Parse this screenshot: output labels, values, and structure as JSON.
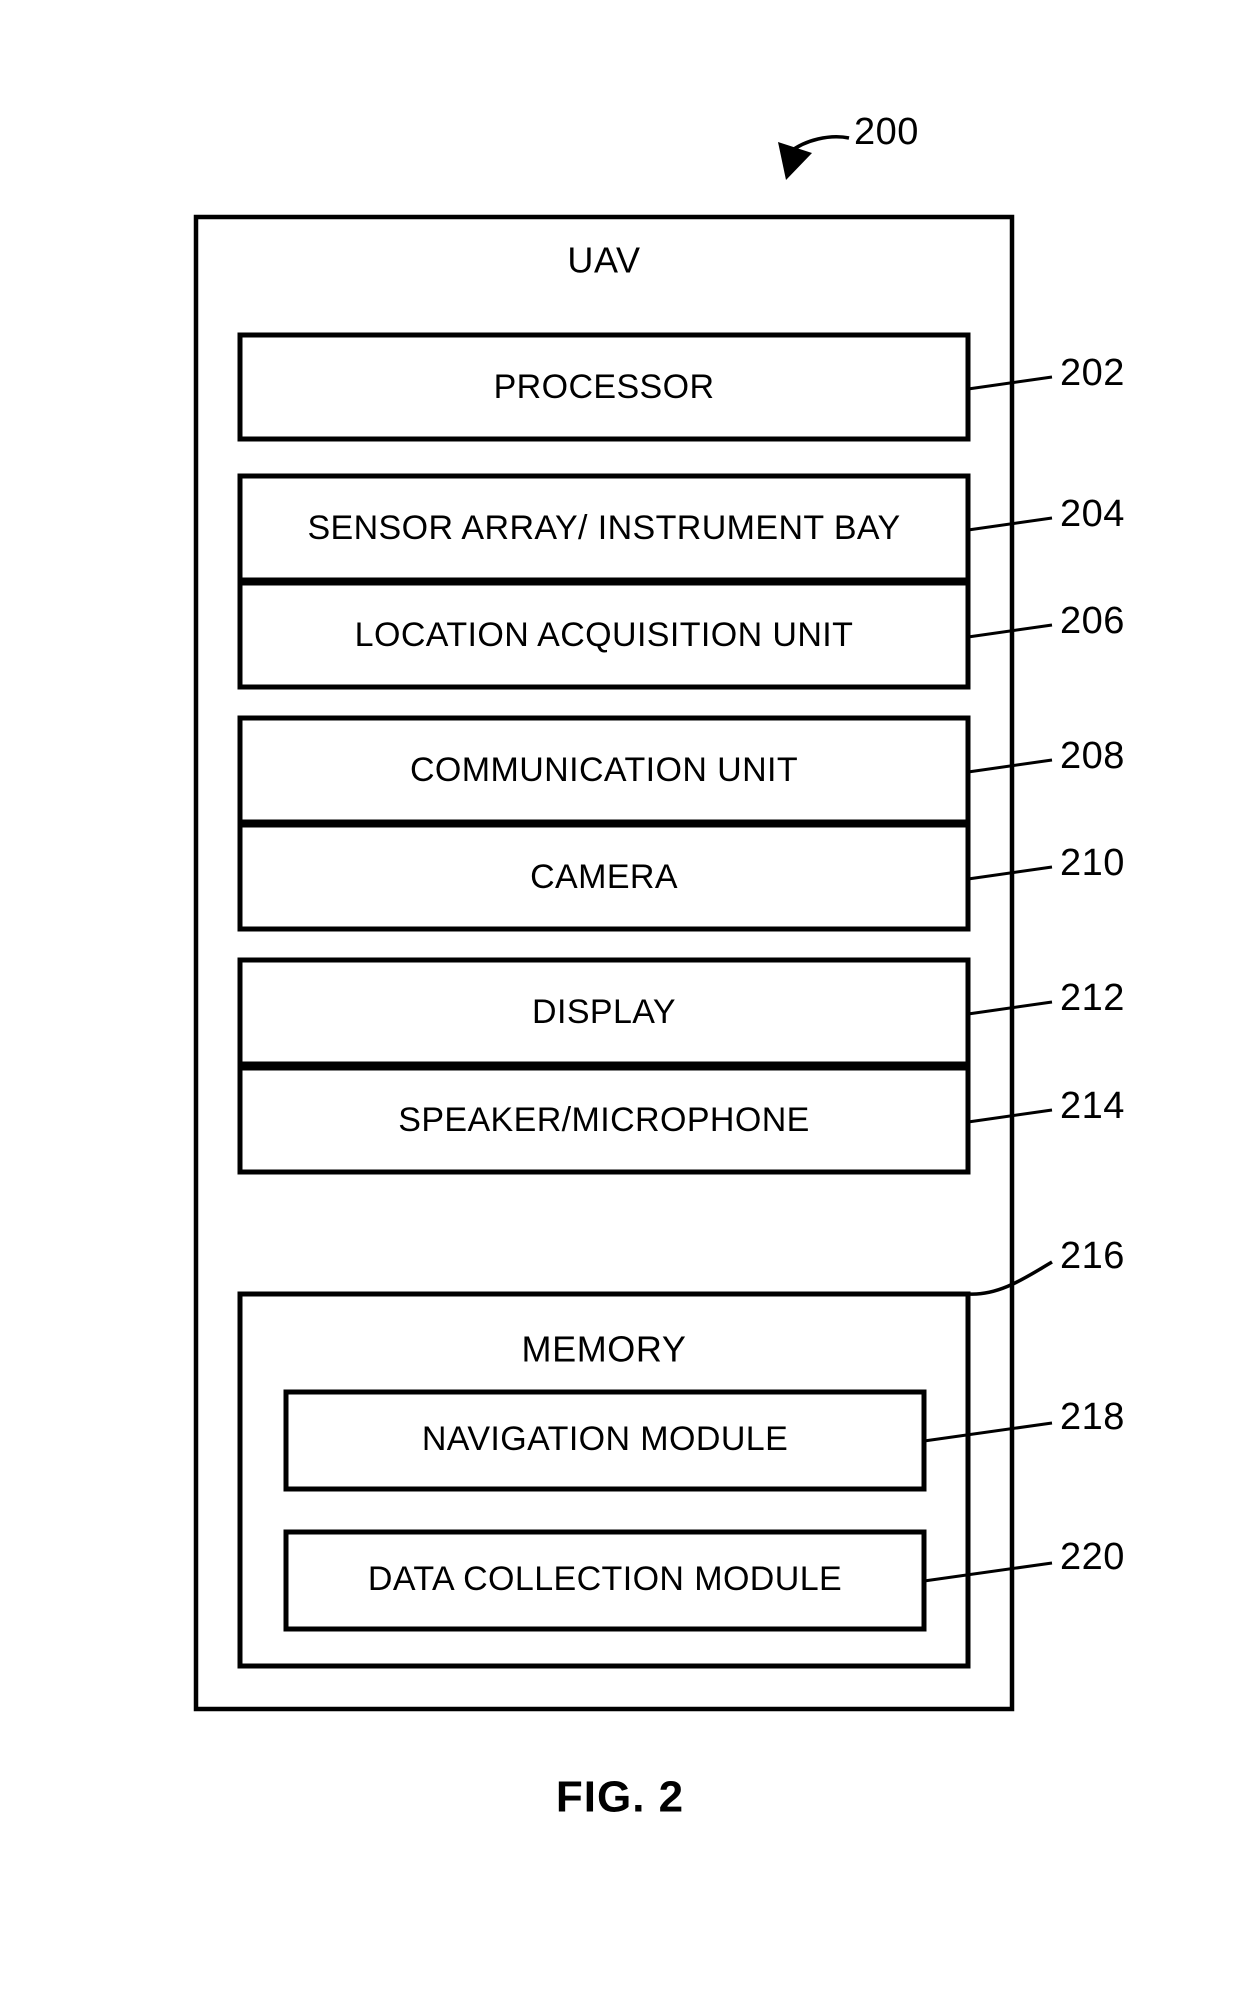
{
  "figure": {
    "caption": "FIG. 2",
    "diagram_reference": "200",
    "container_title": "UAV"
  },
  "diagram": {
    "type": "block-diagram",
    "title": "UAV",
    "components": [
      {
        "label": "PROCESSOR",
        "ref": "202"
      },
      {
        "label": "SENSOR ARRAY/ INSTRUMENT BAY",
        "ref": "204"
      },
      {
        "label": "LOCATION ACQUISITION UNIT",
        "ref": "206"
      },
      {
        "label": "COMMUNICATION UNIT",
        "ref": "208"
      },
      {
        "label": "CAMERA",
        "ref": "210"
      },
      {
        "label": "DISPLAY",
        "ref": "212"
      },
      {
        "label": "SPEAKER/MICROPHONE",
        "ref": "214"
      }
    ],
    "memory": {
      "label": "MEMORY",
      "ref": "216",
      "modules": [
        {
          "label": "NAVIGATION MODULE",
          "ref": "218"
        },
        {
          "label": "DATA COLLECTION MODULE",
          "ref": "220"
        }
      ]
    }
  },
  "style": {
    "line_color": "#000000",
    "background_color": "#ffffff"
  }
}
